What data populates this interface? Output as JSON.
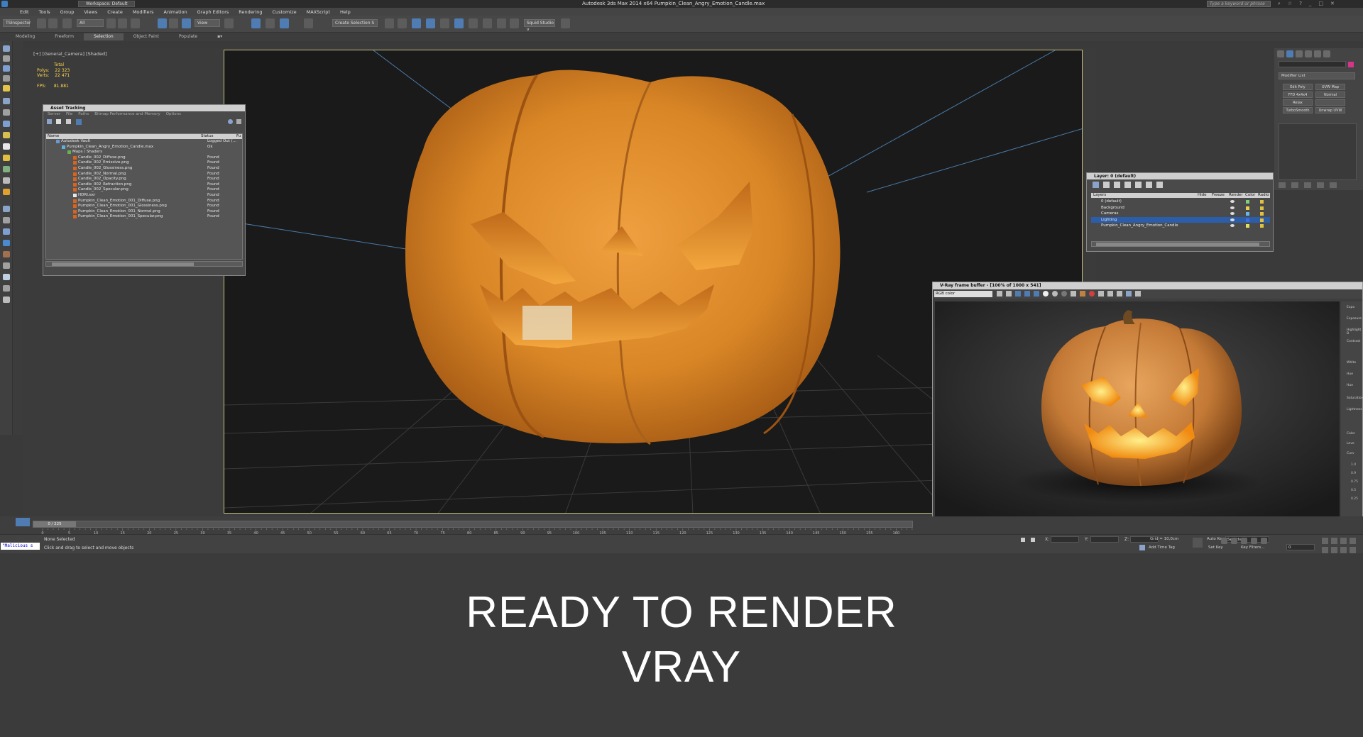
{
  "titlebar": {
    "workspace": "Workspace: Default",
    "title": "Autodesk 3ds Max  2014 x64    Pumpkin_Clean_Angry_Emotion_Candle.max",
    "search_placeholder": "Type a keyword or phrase"
  },
  "menu": [
    "Edit",
    "Tools",
    "Group",
    "Views",
    "Create",
    "Modifiers",
    "Animation",
    "Graph Editors",
    "Rendering",
    "Customize",
    "MAXScript",
    "Help"
  ],
  "toolbar": {
    "left_label": "TSInspector",
    "filter": "All",
    "view": "View",
    "selection_set": "Create Selection S",
    "squid": "Squid Studio v"
  },
  "ribbon": {
    "tabs": [
      "Modeling",
      "Freeform",
      "Selection",
      "Object Paint",
      "Populate"
    ],
    "active": "Selection"
  },
  "viewport": {
    "label": "[+] [General_Camera] [Shaded]",
    "stats": {
      "total": "Total",
      "polys_label": "Polys:",
      "polys": "22 323",
      "verts_label": "Verts:",
      "verts": "22 471",
      "fps_label": "FPS:",
      "fps": "81.881"
    }
  },
  "asset_tracking": {
    "title": "Asset Tracking",
    "menu": [
      "Server",
      "File",
      "Paths",
      "Bitmap Performance and Memory",
      "Options"
    ],
    "columns": [
      "Name",
      "Status",
      "Fu"
    ],
    "rows": [
      {
        "name": "Autodesk Vault",
        "status": "Logged Out (...",
        "indent": 1,
        "kind": "vault"
      },
      {
        "name": "Pumpkin_Clean_Angry_Emotion_Candle.max",
        "status": "Ok",
        "indent": 2,
        "kind": "max"
      },
      {
        "name": "Maps / Shaders",
        "status": "",
        "indent": 3,
        "kind": "folder"
      },
      {
        "name": "Candle_002_Diffuse.png",
        "status": "Found",
        "indent": 4,
        "kind": "map"
      },
      {
        "name": "Candle_002_Emissive.png",
        "status": "Found",
        "indent": 4,
        "kind": "map"
      },
      {
        "name": "Candle_002_Glossiness.png",
        "status": "Found",
        "indent": 4,
        "kind": "map"
      },
      {
        "name": "Candle_002_Normal.png",
        "status": "Found",
        "indent": 4,
        "kind": "map"
      },
      {
        "name": "Candle_002_Opacity.png",
        "status": "Found",
        "indent": 4,
        "kind": "map"
      },
      {
        "name": "Candle_002_Refraction.png",
        "status": "Found",
        "indent": 4,
        "kind": "map"
      },
      {
        "name": "Candle_002_Specular.png",
        "status": "Found",
        "indent": 4,
        "kind": "map"
      },
      {
        "name": "HDRI.exr",
        "status": "Found",
        "indent": 4,
        "kind": "hdri"
      },
      {
        "name": "Pumpkin_Clean_Emotion_001_Diffuse.png",
        "status": "Found",
        "indent": 4,
        "kind": "map"
      },
      {
        "name": "Pumpkin_Clean_Emotion_001_Glossiness.png",
        "status": "Found",
        "indent": 4,
        "kind": "map"
      },
      {
        "name": "Pumpkin_Clean_Emotion_001_Normal.png",
        "status": "Found",
        "indent": 4,
        "kind": "map"
      },
      {
        "name": "Pumpkin_Clean_Emotion_001_Specular.png",
        "status": "Found",
        "indent": 4,
        "kind": "map"
      }
    ]
  },
  "layers": {
    "title": "Layer: 0 (default)",
    "columns": [
      "Layers",
      "Hide",
      "Freeze",
      "Render",
      "Color",
      "Radio"
    ],
    "rows": [
      {
        "name": "0 (default)",
        "selected": false,
        "color": "#7fd07f"
      },
      {
        "name": "Background",
        "selected": false,
        "color": "#e6d24a"
      },
      {
        "name": "Cameras",
        "selected": false,
        "color": "#6ab7e6"
      },
      {
        "name": "Lighting",
        "selected": true,
        "color": "#3d6fe0"
      },
      {
        "name": "Pumpkin_Clean_Angry_Emotion_Candle",
        "selected": false,
        "color": "#e0e060"
      }
    ]
  },
  "vray": {
    "title": "V-Ray frame buffer - [100% of 1000 x 541]",
    "channel": "RGB color",
    "side_labels": [
      "Expo",
      "Exposure",
      "Highlight B",
      "Contrast",
      "White",
      "Hue",
      "Hue",
      "Saturation",
      "Lightness",
      "Color",
      "Leve",
      "Curv"
    ],
    "curve_values": [
      "1.0",
      "0.9",
      "0.75",
      "0.5",
      "0.25"
    ]
  },
  "timeline": {
    "frame": "0 / 225",
    "ticks": [
      "0",
      "5",
      "10",
      "15",
      "20",
      "25",
      "30",
      "35",
      "40",
      "45",
      "50",
      "55",
      "60",
      "65",
      "70",
      "75",
      "80",
      "85",
      "90",
      "95",
      "100",
      "105",
      "110",
      "115",
      "120",
      "125",
      "130",
      "135",
      "140",
      "145",
      "150",
      "155",
      "160"
    ]
  },
  "status": {
    "maxscript": "\"Malicious s",
    "selection": "None Selected",
    "prompt": "Click and drag to select and move objects",
    "x_label": "X:",
    "y_label": "Y:",
    "z_label": "Z:",
    "grid": "Grid = 10,0cm",
    "add_time_tag": "Add Time Tag",
    "auto_key": "Auto Key",
    "selected": "Selected",
    "set_key": "Set Key",
    "key_filters": "Key Filters...",
    "frame_field": "0"
  },
  "command_panel": {
    "modifier_list": "Modifier List",
    "buttons": [
      "Edit Poly",
      "UVW Map",
      "FFD 4x4x4",
      "Normal",
      "Relax",
      "",
      "TurboSmooth",
      "Unwrap UVW"
    ]
  },
  "caption": {
    "line1": "READY TO RENDER",
    "line2": "VRAY"
  },
  "colors": {
    "accent_blue": "#3d6fe0",
    "pumpkin_orange": "#e08a2a",
    "stats_yellow": "#ffd84a"
  }
}
